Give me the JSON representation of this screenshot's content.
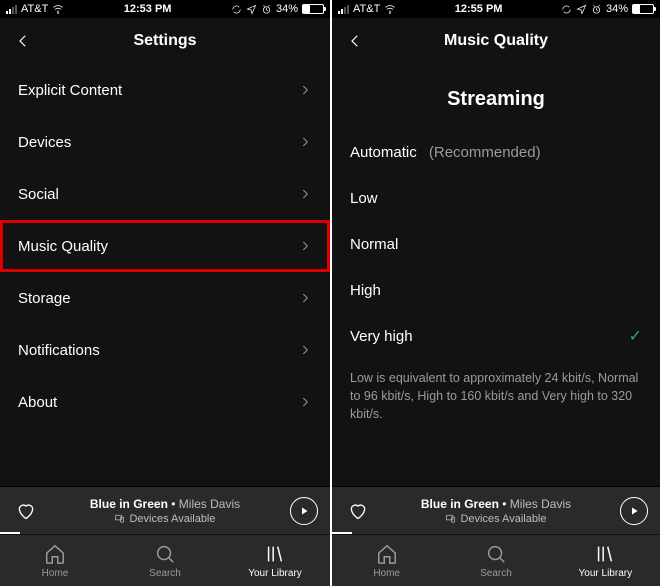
{
  "left": {
    "status": {
      "carrier": "AT&T",
      "time": "12:53 PM",
      "battery": "34%"
    },
    "header": {
      "title": "Settings"
    },
    "rows": [
      {
        "label": "Explicit Content"
      },
      {
        "label": "Devices"
      },
      {
        "label": "Social"
      },
      {
        "label": "Music Quality",
        "highlight": true
      },
      {
        "label": "Storage"
      },
      {
        "label": "Notifications"
      },
      {
        "label": "About"
      }
    ],
    "nowplaying": {
      "track": "Blue in Green",
      "sep": " • ",
      "artist": "Miles Davis",
      "devices": "Devices Available"
    },
    "tabs": {
      "home": "Home",
      "search": "Search",
      "library": "Your Library"
    }
  },
  "right": {
    "status": {
      "carrier": "AT&T",
      "time": "12:55 PM",
      "battery": "34%"
    },
    "header": {
      "title": "Music Quality"
    },
    "section": "Streaming",
    "options": [
      {
        "label": "Automatic",
        "sub": "(Recommended)"
      },
      {
        "label": "Low"
      },
      {
        "label": "Normal"
      },
      {
        "label": "High"
      },
      {
        "label": "Very high",
        "selected": true
      }
    ],
    "help": "Low is equivalent to approximately 24 kbit/s, Normal to 96 kbit/s, High to 160 kbit/s and Very high to 320 kbit/s.",
    "nowplaying": {
      "track": "Blue in Green",
      "sep": " • ",
      "artist": "Miles Davis",
      "devices": "Devices Available"
    },
    "tabs": {
      "home": "Home",
      "search": "Search",
      "library": "Your Library"
    }
  }
}
